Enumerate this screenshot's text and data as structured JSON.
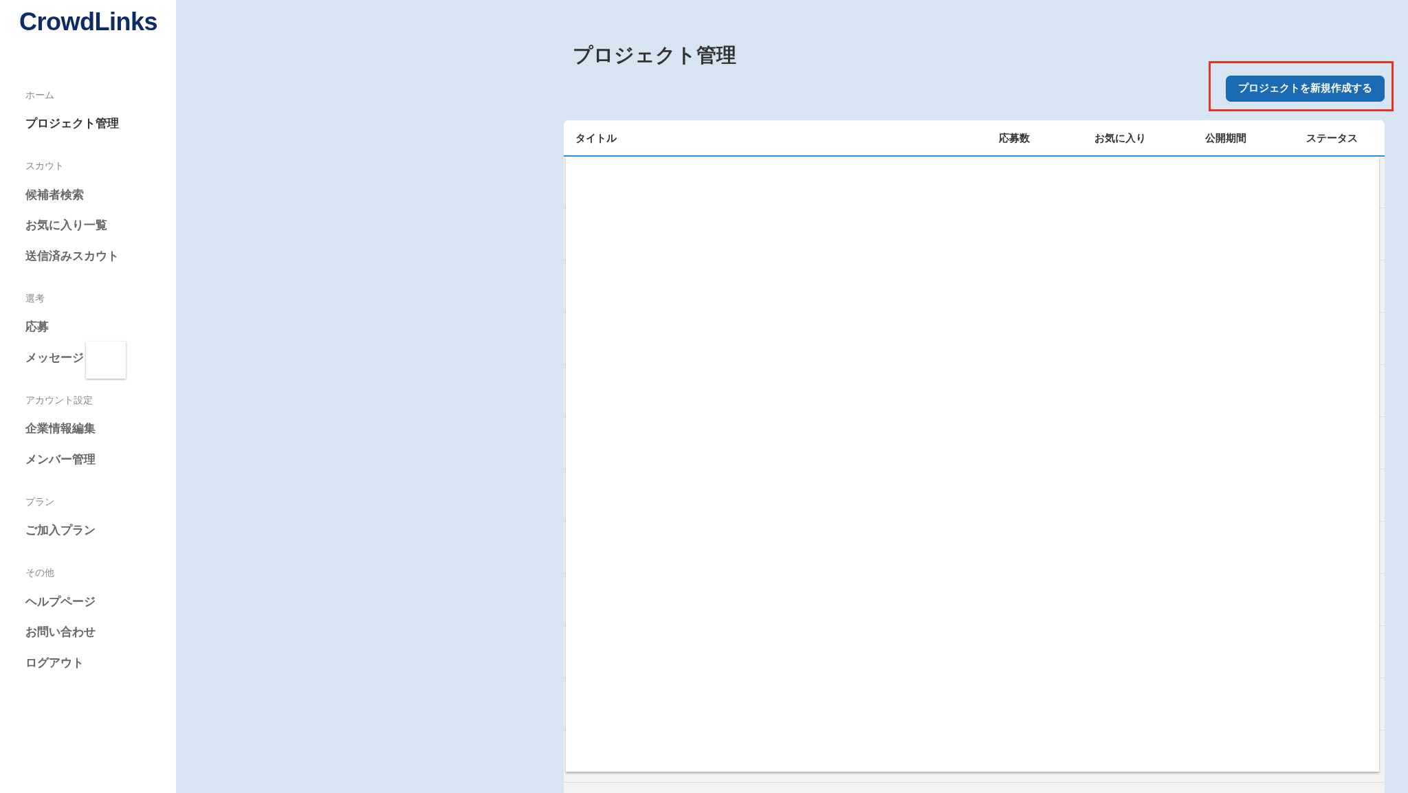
{
  "logo": {
    "text": "CrowdLinks"
  },
  "sidebar": {
    "sections": [
      {
        "label": "ホーム",
        "items": [
          {
            "label": "プロジェクト管理",
            "selected": true
          }
        ]
      },
      {
        "label": "スカウト",
        "items": [
          {
            "label": "候補者検索",
            "selected": false
          },
          {
            "label": "お気に入り一覧",
            "selected": false
          },
          {
            "label": "送信済みスカウト",
            "selected": false
          }
        ]
      },
      {
        "label": "選考",
        "items": [
          {
            "label": "応募",
            "selected": false
          },
          {
            "label": "メッセージ",
            "selected": false,
            "empty_popup": true
          }
        ]
      },
      {
        "label": "アカウント設定",
        "items": [
          {
            "label": "企業情報編集",
            "selected": false
          },
          {
            "label": "メンバー管理",
            "selected": false
          }
        ]
      },
      {
        "label": "プラン",
        "items": [
          {
            "label": "ご加入プラン",
            "selected": false
          }
        ]
      },
      {
        "label": "その他",
        "items": [
          {
            "label": "ヘルプページ",
            "selected": false
          },
          {
            "label": "お問い合わせ",
            "selected": false
          },
          {
            "label": "ログアウト",
            "selected": false
          }
        ]
      }
    ]
  },
  "main": {
    "title": "プロジェクト管理",
    "new_button": {
      "label": "プロジェクトを新規作成する",
      "highlighted": true
    }
  },
  "table": {
    "columns": [
      "タイトル",
      "応募数",
      "お気に入り",
      "公開期間",
      "ステータス"
    ]
  }
}
